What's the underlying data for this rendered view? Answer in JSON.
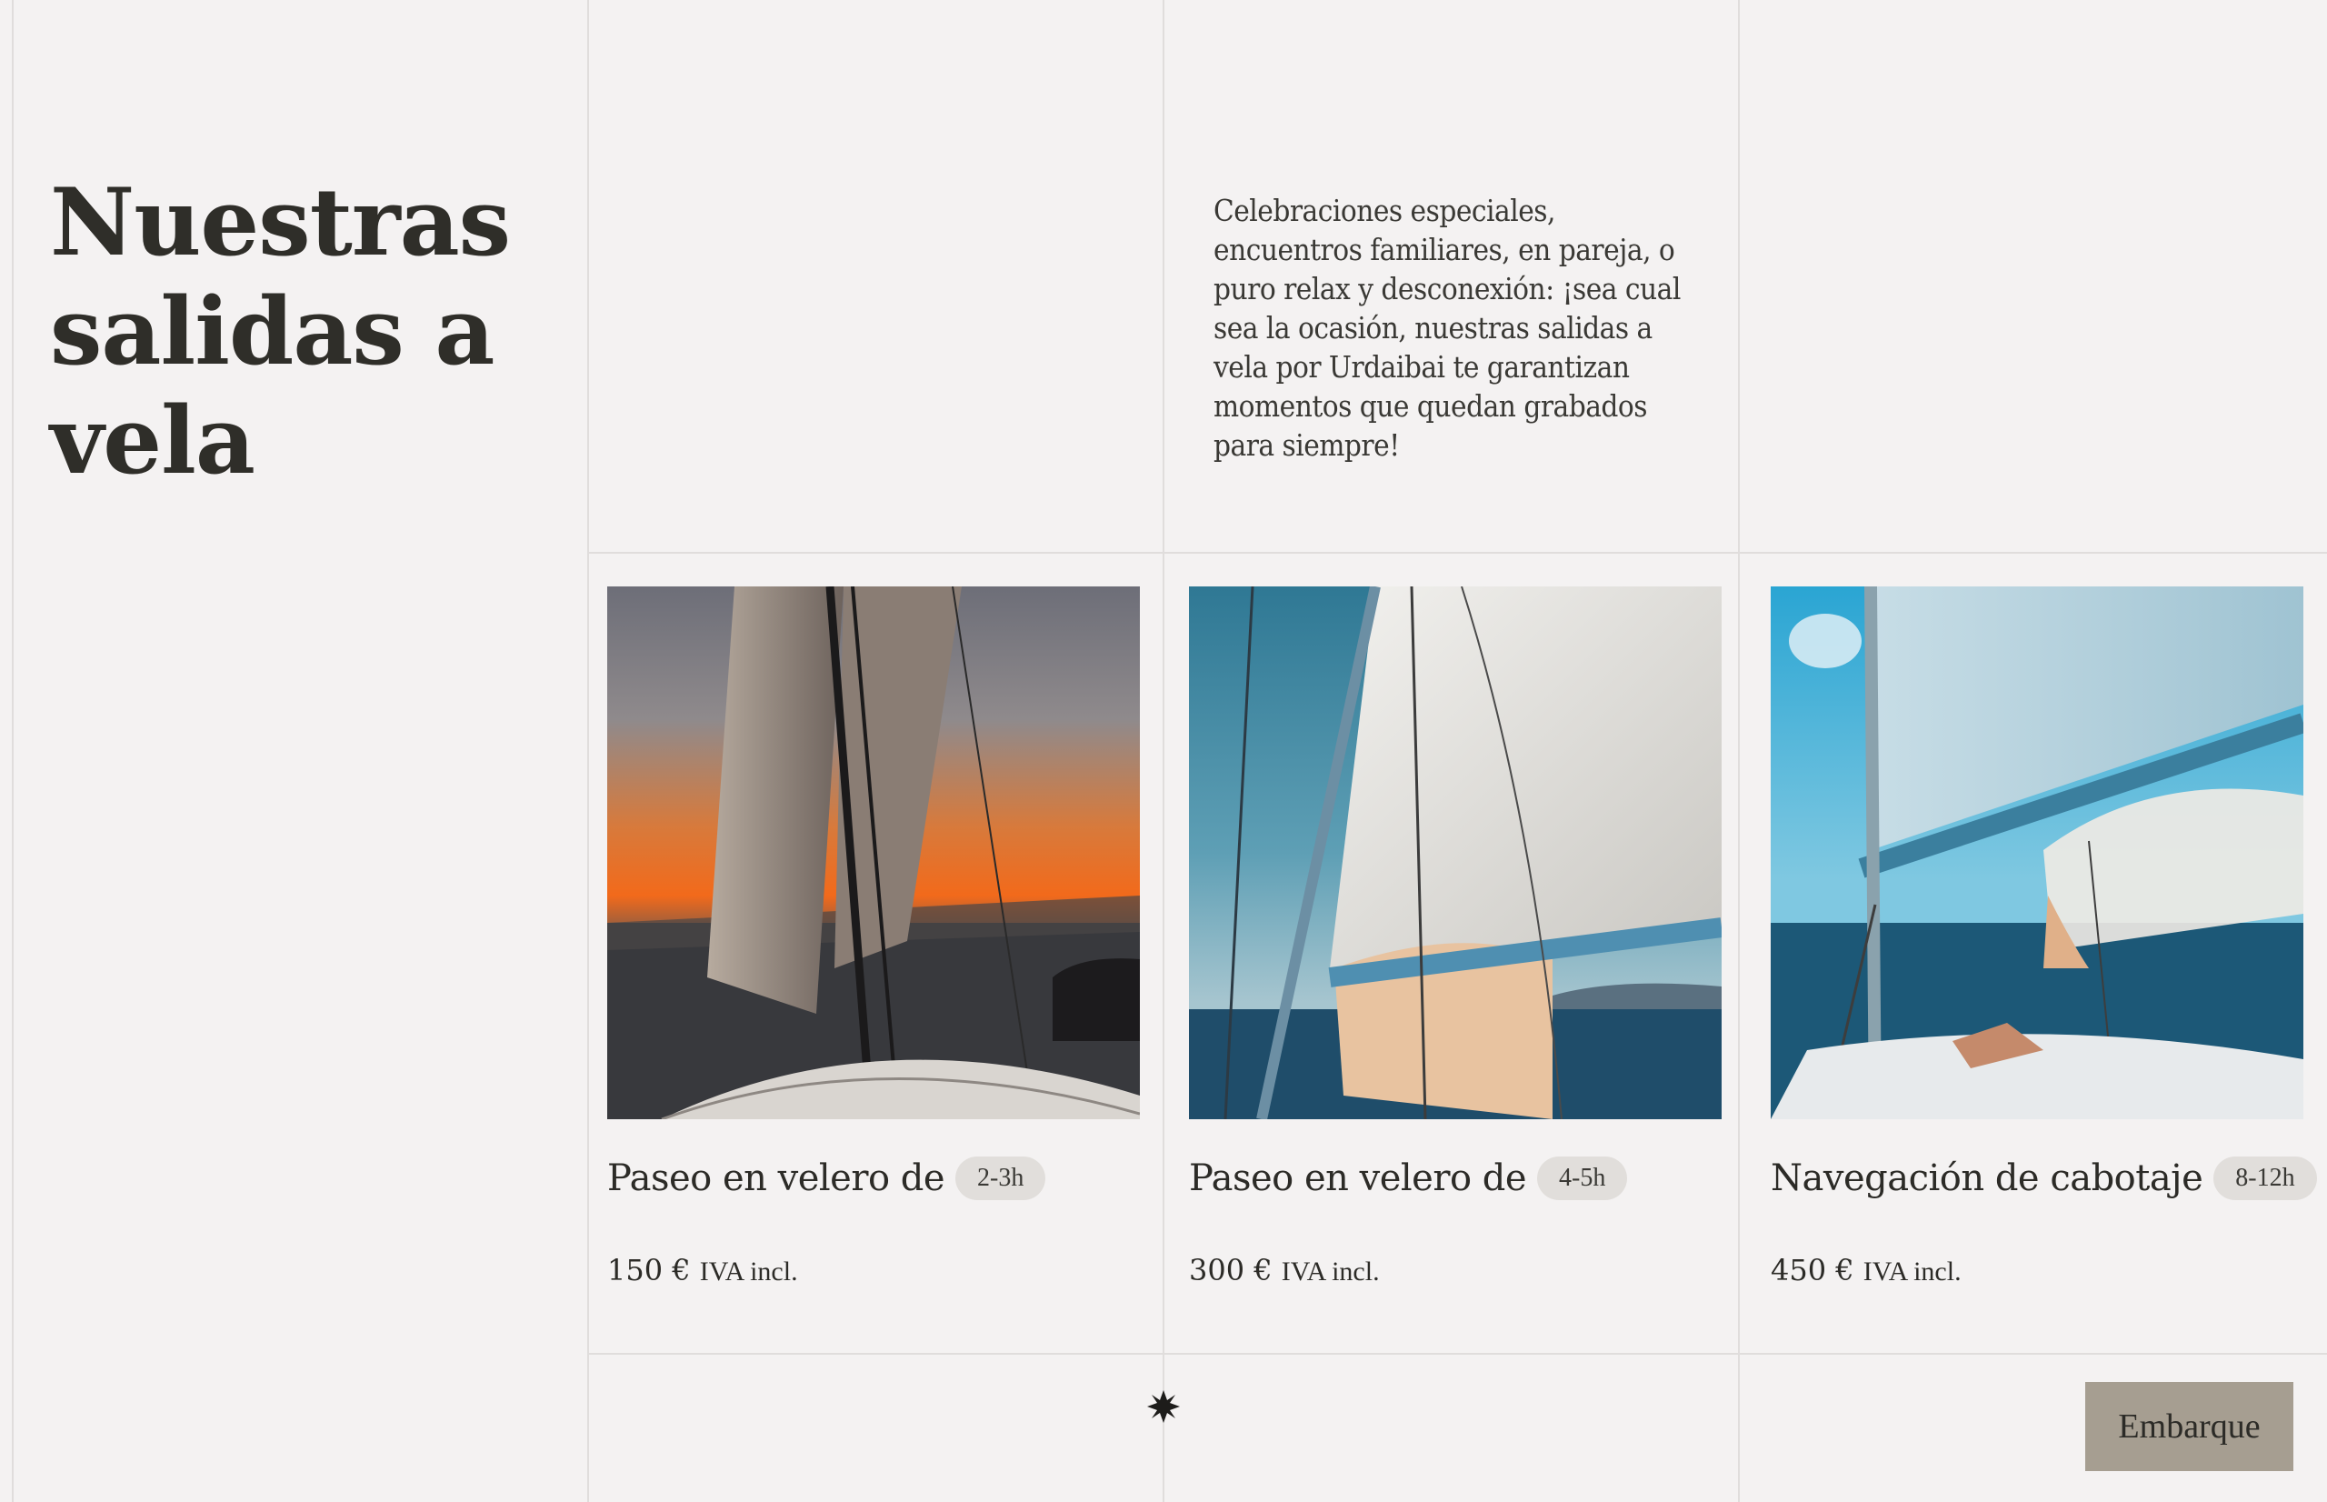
{
  "section": {
    "title": "Nuestras salidas a vela",
    "intro": "Celebraciones especiales, encuentros familiares, en pareja, o puro relax y desconexión: ¡sea cual sea la ocasión, nuestras salidas a vela por Urdaibai te garantizan momentos que quedan grabados para siempre!"
  },
  "cards": [
    {
      "title": "Paseo en velero de",
      "duration": "2-3h",
      "price": "150 €",
      "price_note": "IVA incl.",
      "image": "sunset-sailing-photo"
    },
    {
      "title": "Paseo en velero de",
      "duration": "4-5h",
      "price": "300 €",
      "price_note": "IVA incl.",
      "image": "mainsail-sailing-photo"
    },
    {
      "title": "Navegación de cabotaje",
      "duration": "8-12h",
      "price": "450 €",
      "price_note": "IVA incl.",
      "image": "coastal-sailing-photo"
    }
  ],
  "cta": {
    "label": "Embarque"
  },
  "icons": {
    "divider": "star-icon"
  },
  "colors": {
    "background": "#f4f2f2",
    "cta": "#a69e91",
    "pill": "#e1dedb",
    "text": "#2c2b27"
  }
}
